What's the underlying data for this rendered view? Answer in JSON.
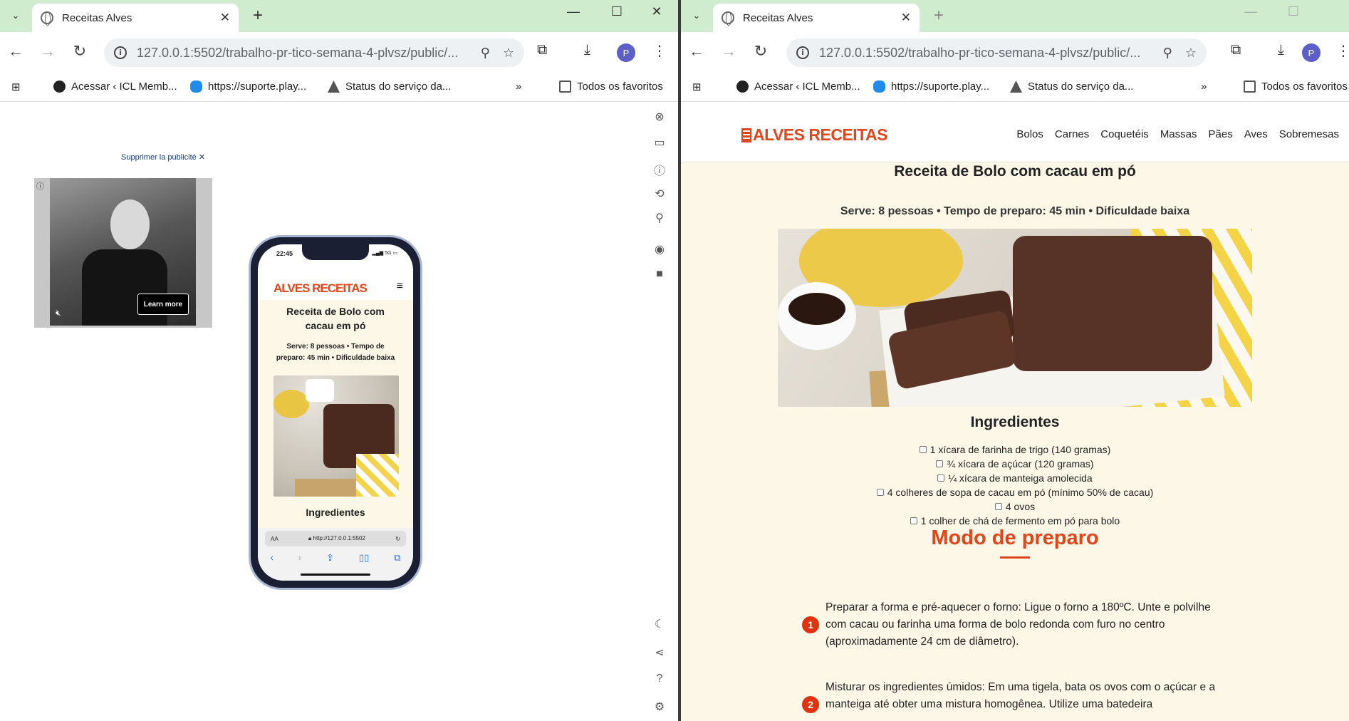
{
  "left_window": {
    "tab_title": "Receitas Alves",
    "url": "127.0.0.1:5502/trabalho-pr-tico-semana-4-plvsz/public/...",
    "profile_initial": "P",
    "bookmarks": [
      "Acessar ‹ ICL Memb...",
      "https://suporte.play...",
      "Status do serviço da...",
      "Todos os favoritos"
    ],
    "ad": {
      "close_label": "Supprimer la publicité",
      "button_label": "Learn more"
    },
    "phone": {
      "time": "22:45",
      "signal": "5G",
      "logo": "ALVES RECEITAS",
      "title": "Receita de Bolo com cacau em pó",
      "meta": "Serve: 8 pessoas • Tempo de preparo: 45 min • Dificuldade baixa",
      "ingredients_title": "Ingredientes",
      "address_aa": "AA",
      "address_url": "http://127.0.0.1:5502"
    }
  },
  "right_window": {
    "tab_title": "Receitas Alves",
    "url": "127.0.0.1:5502/trabalho-pr-tico-semana-4-plvsz/public/...",
    "profile_initial": "P",
    "bookmarks": [
      "Acessar ‹ ICL Memb...",
      "https://suporte.play...",
      "Status do serviço da...",
      "Todos os favoritos"
    ]
  },
  "site": {
    "logo": "ALVES RECEITAS",
    "menu": [
      "Bolos",
      "Carnes",
      "Coquetéis",
      "Massas",
      "Pães",
      "Aves",
      "Sobremesas"
    ],
    "recipe_title": "Receita de Bolo com cacau em pó",
    "recipe_meta": "Serve: 8 pessoas • Tempo de preparo: 45 min • Dificuldade baixa",
    "ingredients_title": "Ingredientes",
    "ingredients": [
      "1 xícara de farinha de trigo (140 gramas)",
      "¾ xícara de açúcar (120 gramas)",
      "¼ xícara de manteiga amolecida",
      "4 colheres de sopa de cacau em pó (mínimo 50% de cacau)",
      "4 ovos",
      "1 colher de chá de fermento em pó para bolo"
    ],
    "method_title": "Modo de preparo",
    "steps": [
      {
        "num": "1",
        "text": "Preparar a forma e pré-aquecer o forno: Ligue o forno a 180ºC. Unte e polvilhe com cacau ou farinha uma forma de bolo redonda com furo no centro (aproximadamente 24 cm de diâmetro)."
      },
      {
        "num": "2",
        "text": "Misturar os ingredientes úmidos: Em uma tigela, bata os ovos com o açúcar e a manteiga até obter uma mistura homogênea. Utilize uma batedeira"
      }
    ]
  },
  "colors": {
    "accent": "#e0461c",
    "page_bg": "#fdf7e8",
    "tabstrip": "#cfeccf"
  }
}
